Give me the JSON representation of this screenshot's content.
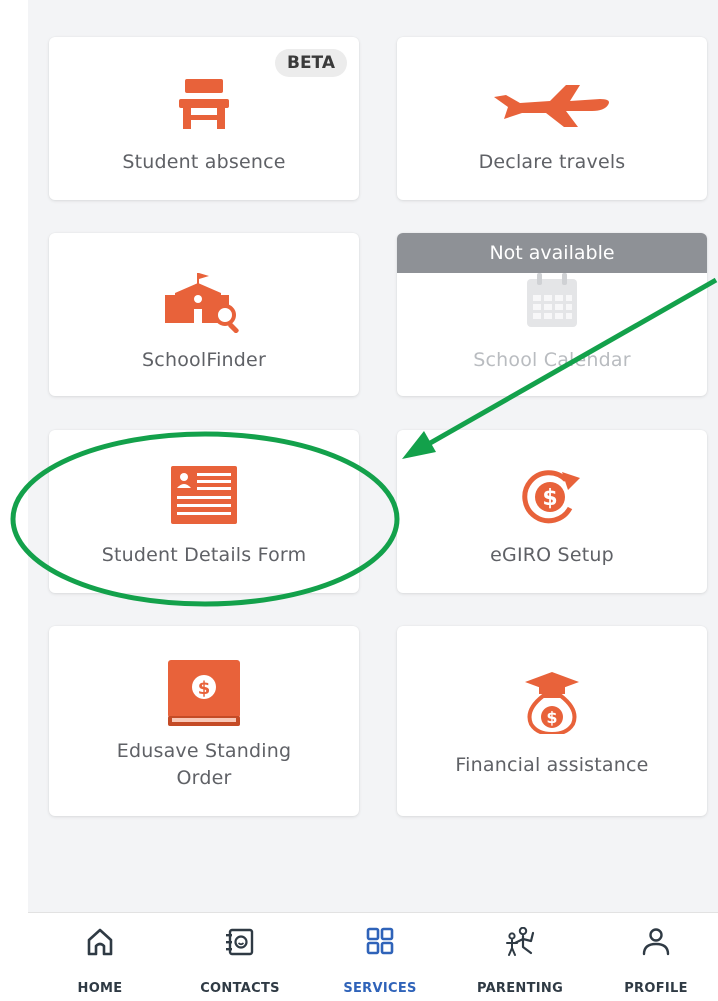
{
  "colors": {
    "accent": "#e8623a",
    "annotation": "#13a14b",
    "nav_active": "#2f63b9"
  },
  "tiles": {
    "student_absence": {
      "label": "Student absence",
      "badge": "BETA",
      "icon": "desk-icon"
    },
    "declare_travels": {
      "label": "Declare travels",
      "icon": "airplane-icon"
    },
    "schoolfinder": {
      "label": "SchoolFinder",
      "icon": "school-search-icon"
    },
    "school_calendar": {
      "label": "School Calendar",
      "banner": "Not available",
      "icon": "calendar-icon"
    },
    "student_details_form": {
      "label": "Student Details Form",
      "icon": "form-icon"
    },
    "egiro_setup": {
      "label": "eGIRO Setup",
      "icon": "dollar-cycle-icon"
    },
    "edusave_standing_order": {
      "label_line1": "Edusave Standing",
      "label_line2": "Order",
      "icon": "dollar-book-icon"
    },
    "financial_assistance": {
      "label": "Financial assistance",
      "icon": "money-bag-graduate-icon"
    }
  },
  "nav": {
    "home": "HOME",
    "contacts": "CONTACTS",
    "services": "SERVICES",
    "parenting": "PARENTING",
    "profile": "PROFILE",
    "active": "services"
  }
}
